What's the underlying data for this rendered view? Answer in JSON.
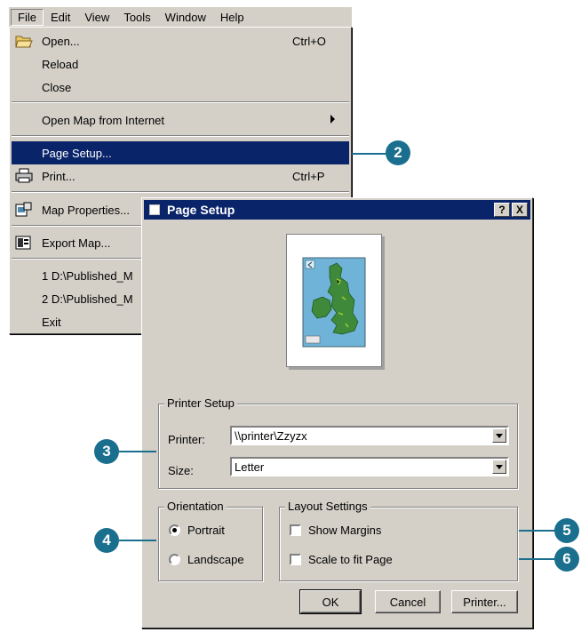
{
  "menubar": {
    "items": [
      "File",
      "Edit",
      "View",
      "Tools",
      "Window",
      "Help"
    ]
  },
  "file_menu": {
    "open": "Open...",
    "open_shortcut": "Ctrl+O",
    "reload": "Reload",
    "close": "Close",
    "open_map_internet": "Open Map from Internet",
    "page_setup": "Page Setup...",
    "print": "Print...",
    "print_shortcut": "Ctrl+P",
    "map_properties": "Map Properties...",
    "export_map": "Export Map...",
    "recent1": "1 D:\\Published_M",
    "recent2": "2 D:\\Published_M",
    "exit": "Exit"
  },
  "callouts": {
    "c2": "2",
    "c3": "3",
    "c4": "4",
    "c5": "5",
    "c6": "6"
  },
  "dialog": {
    "title": "Page Setup",
    "help_btn": "?",
    "close_btn": "X",
    "printer_setup": {
      "legend": "Printer Setup",
      "printer_label": "Printer:",
      "printer_value": "\\\\printer\\Zzyzx",
      "size_label": "Size:",
      "size_value": "Letter"
    },
    "orientation": {
      "legend": "Orientation",
      "portrait": "Portrait",
      "landscape": "Landscape",
      "selected": "Portrait"
    },
    "layout_settings": {
      "legend": "Layout Settings",
      "show_margins": "Show Margins",
      "scale_to_fit": "Scale to fit Page"
    },
    "buttons": {
      "ok": "OK",
      "cancel": "Cancel",
      "printer": "Printer..."
    }
  },
  "colors": {
    "highlight": "#0a246a",
    "callout": "#1a6f8f",
    "face": "#d4d0c8"
  }
}
